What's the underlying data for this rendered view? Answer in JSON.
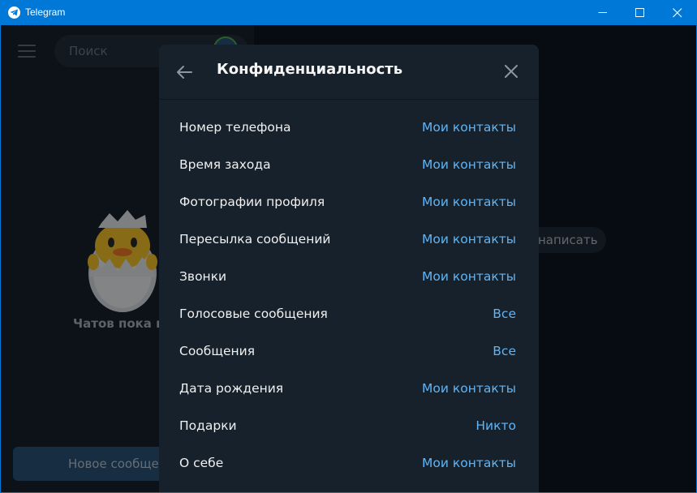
{
  "window": {
    "title": "Telegram",
    "icon": "telegram-icon",
    "controls": [
      "minimize-icon",
      "maximize-icon",
      "close-icon"
    ],
    "accent": "#0078d7"
  },
  "sidebar": {
    "menu_icon": "hamburger-icon",
    "search": {
      "placeholder": "Поиск",
      "value": ""
    },
    "empty_state": {
      "text": "Чатов пока н",
      "illustration": "hatching-duck-sticker"
    },
    "new_message_button": {
      "label": "Новое сообще"
    }
  },
  "main": {
    "write_button": {
      "label": "написать"
    }
  },
  "dialog": {
    "title": "Конфиденциальность",
    "back_icon": "arrow-left-icon",
    "close_icon": "close-icon",
    "value_color": "#5eb5f7",
    "rows": [
      {
        "label": "Номер телефона",
        "value": "Мои контакты"
      },
      {
        "label": "Время захода",
        "value": "Мои контакты"
      },
      {
        "label": "Фотографии профиля",
        "value": "Мои контакты"
      },
      {
        "label": "Пересылка сообщений",
        "value": "Мои контакты"
      },
      {
        "label": "Звонки",
        "value": "Мои контакты"
      },
      {
        "label": "Голосовые сообщения",
        "value": "Все"
      },
      {
        "label": "Сообщения",
        "value": "Все"
      },
      {
        "label": "Дата рождения",
        "value": "Мои контакты"
      },
      {
        "label": "Подарки",
        "value": "Никто"
      },
      {
        "label": "О себе",
        "value": "Мои контакты"
      }
    ]
  }
}
